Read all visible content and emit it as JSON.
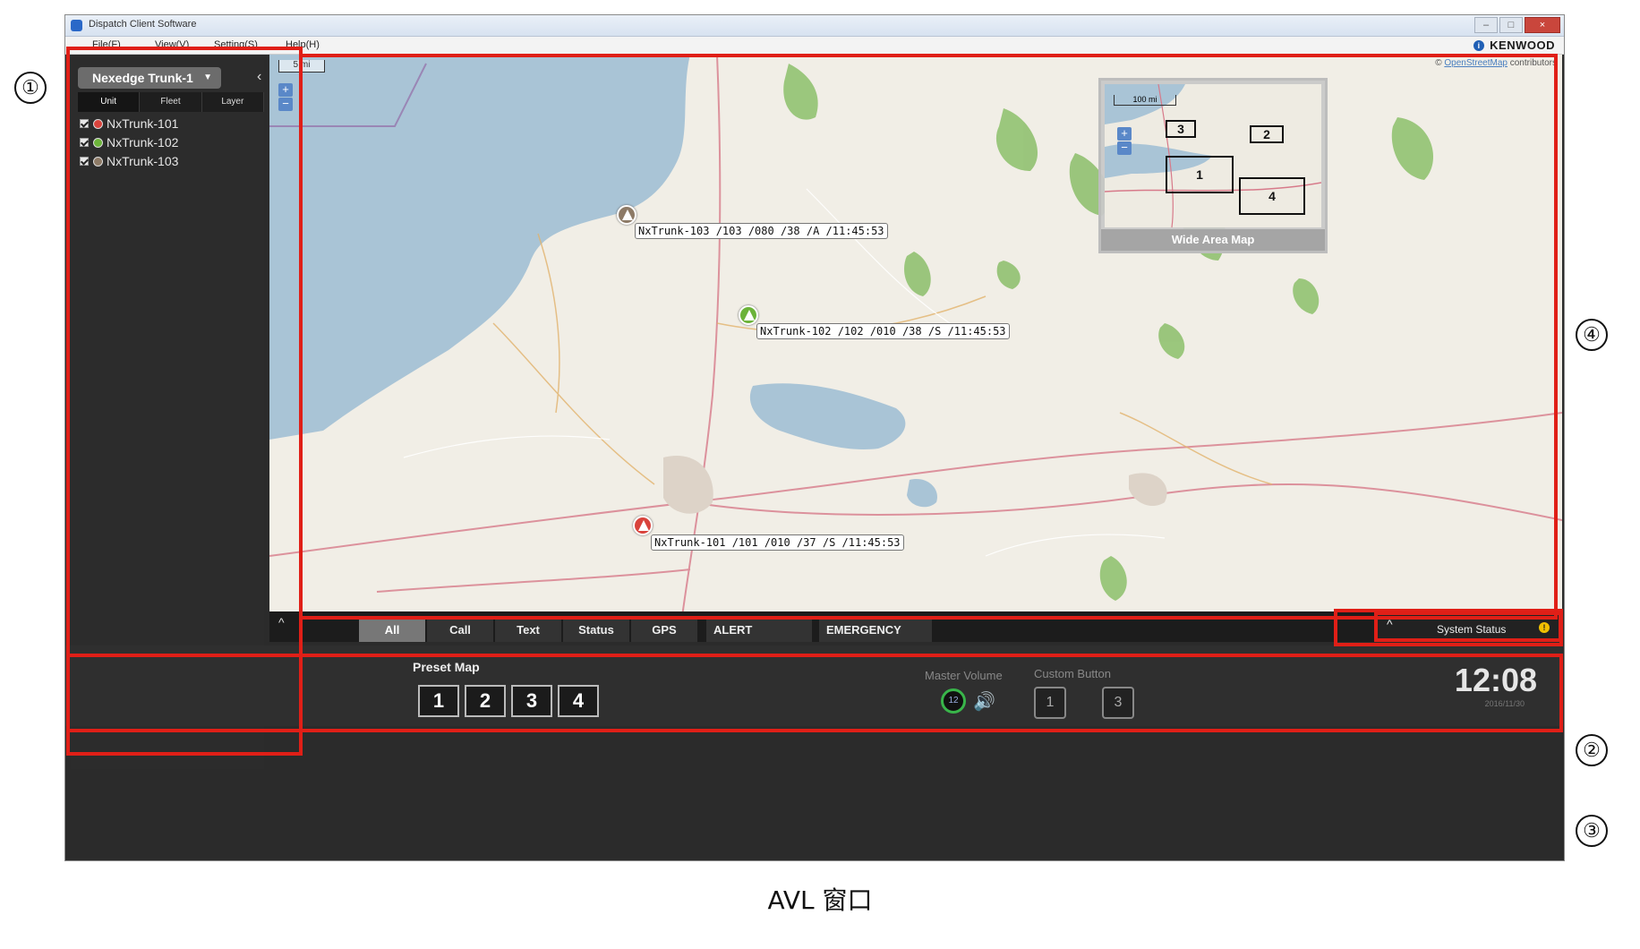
{
  "window": {
    "title": "Dispatch Client Software",
    "controls": [
      "–",
      "□",
      "×"
    ]
  },
  "menu": {
    "items": [
      "File(F)",
      "View(V)",
      "Setting(S)",
      "Help(H)"
    ],
    "brand": "KENWOOD",
    "info_icon": "i"
  },
  "left_panel": {
    "trunk_select": "Nexedge Trunk-1",
    "tabs": [
      "Unit",
      "Fleet",
      "Layer"
    ],
    "units": [
      {
        "label": "NxTrunk-101",
        "color": "#d9433c"
      },
      {
        "label": "NxTrunk-102",
        "color": "#6cb33a"
      },
      {
        "label": "NxTrunk-103",
        "color": "#8d7a66"
      }
    ]
  },
  "map": {
    "scale": "5 mi",
    "zoom_in": "+",
    "zoom_out": "−",
    "attribution_symbol": "©",
    "attribution_link": "OpenStreetMap",
    "attribution_rest": "contributors",
    "markers": [
      {
        "label": "NxTrunk-103  /103 /080 /38 /A /11:45:53",
        "color": "#8d7a66"
      },
      {
        "label": "NxTrunk-102  /102 /010 /38 /S /11:45:53",
        "color": "#6cb33a"
      },
      {
        "label": "NxTrunk-101  /101 /010 /37 /S /11:45:53",
        "color": "#d9433c"
      }
    ],
    "wide_area": {
      "scale": "100 mi",
      "caption": "Wide Area Map",
      "boxes": [
        "3",
        "2",
        "1",
        "4"
      ]
    }
  },
  "filter_bar": {
    "up": "^",
    "tabs": [
      "All",
      "Call",
      "Text",
      "Status",
      "GPS",
      "ALERT",
      "EMERGENCY"
    ],
    "system_status": "System Status",
    "warning": "!"
  },
  "bottom_bar": {
    "preset_label": "Preset Map",
    "presets": [
      "1",
      "2",
      "3",
      "4"
    ],
    "master_volume_label": "Master Volume",
    "master_volume_value": "12",
    "speaker": "🔊",
    "custom_button_label": "Custom Button",
    "custom_buttons": [
      "1",
      "3"
    ],
    "clock": "12:08",
    "date": "2016/11/30"
  },
  "annotations": {
    "callouts": [
      "①",
      "②",
      "③",
      "④"
    ],
    "caption": "AVL 窗口"
  },
  "colors": {
    "annotation_red": "#e01f17",
    "panel_dark": "#2c2c2c",
    "map_background": "#f1eee6",
    "water": "#a9c4d6",
    "forest": "#8cbf6a"
  }
}
